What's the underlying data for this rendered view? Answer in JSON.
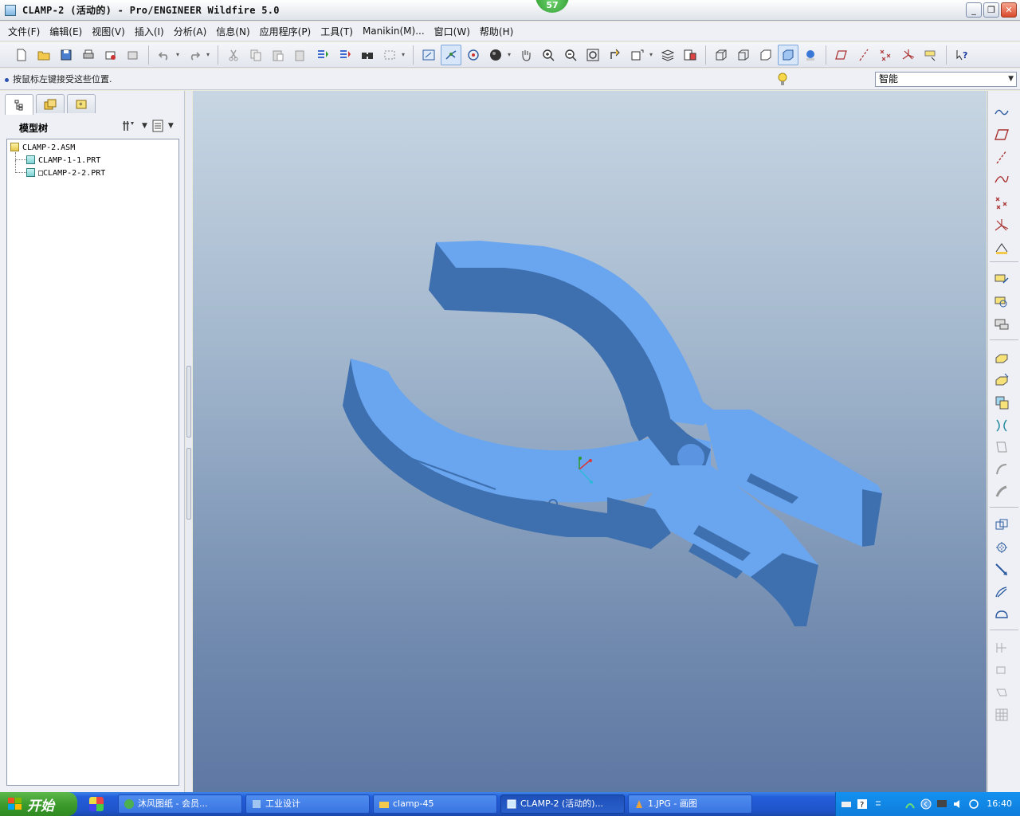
{
  "window": {
    "title": "CLAMP-2 (活动的) - Pro/ENGINEER Wildfire 5.0",
    "badge": "57",
    "controls": [
      "_",
      "❐",
      "✕"
    ]
  },
  "menu": [
    "文件(F)",
    "编辑(E)",
    "视图(V)",
    "插入(I)",
    "分析(A)",
    "信息(N)",
    "应用程序(P)",
    "工具(T)",
    "Manikin(M)...",
    "窗口(W)",
    "帮助(H)"
  ],
  "status": {
    "message": "按鼠标左键接受这些位置.",
    "filter_value": "智能"
  },
  "navigator": {
    "title": "模型树",
    "tabs": [
      "model-tree-tab",
      "folder-browser-tab",
      "favorites-tab"
    ],
    "tree": [
      {
        "label": "CLAMP-2.ASM",
        "type": "assembly"
      },
      {
        "label": "CLAMP-1-1.PRT",
        "type": "part"
      },
      {
        "label": "□CLAMP-2-2.PRT",
        "type": "part"
      }
    ]
  },
  "toolbar_icons": [
    "new-file-icon",
    "open-icon",
    "save-icon",
    "print-icon",
    "send-mail-icon",
    "send-attach-icon",
    "undo-icon",
    "redo-icon",
    "cut-icon",
    "copy-icon",
    "paste-icon",
    "paste-special-icon",
    "regenerate-icon",
    "regen-manager-icon",
    "find-icon",
    "select-box-icon",
    "repaint-icon",
    "spin-center-icon",
    "orient-mode-icon",
    "display-style-icon",
    "pan-icon",
    "zoom-in-icon",
    "zoom-out-icon",
    "refit-icon",
    "reorient-icon",
    "saved-views-icon",
    "layers-icon",
    "view-manager-icon",
    "wireframe-icon",
    "hidden-line-icon",
    "no-hidden-icon",
    "shading-icon",
    "enhanced-realism-icon",
    "datum-planes-icon",
    "datum-axes-icon",
    "datum-points-icon",
    "csys-icon",
    "annotations-icon",
    "context-help-icon"
  ],
  "right_toolbar_icons": [
    "sketch-icon",
    "datum-plane-icon",
    "datum-axis-icon",
    "datum-curve-icon",
    "datum-point-icon",
    "datum-csys-icon",
    "analysis-icon",
    "assemble-icon",
    "create-component-icon",
    "package-icon",
    "extrude-icon",
    "revolve-icon",
    "sweep-icon",
    "hole-icon",
    "shell-icon",
    "rib-icon",
    "draft-icon",
    "round-icon",
    "chamfer-icon",
    "pattern-icon",
    "mirror-icon",
    "merge-icon",
    "trim-icon",
    "offset-icon",
    "thicken-icon",
    "solidify-icon",
    "grid-icon"
  ],
  "taskbar": {
    "start_label": "开始",
    "tasks": [
      {
        "label": "沐风图纸 - 会员...",
        "active": false
      },
      {
        "label": "工业设计",
        "active": false
      },
      {
        "label": "clamp-45",
        "active": false
      },
      {
        "label": "CLAMP-2 (活动的)...",
        "active": true
      },
      {
        "label": "1.JPG - 画图",
        "active": false
      }
    ],
    "clock": "16:40"
  },
  "colors": {
    "model": "#5b9bea",
    "model_shadow": "#3e6fae",
    "viewport_top": "#c8d6e3",
    "viewport_bottom": "#5e78a4"
  }
}
